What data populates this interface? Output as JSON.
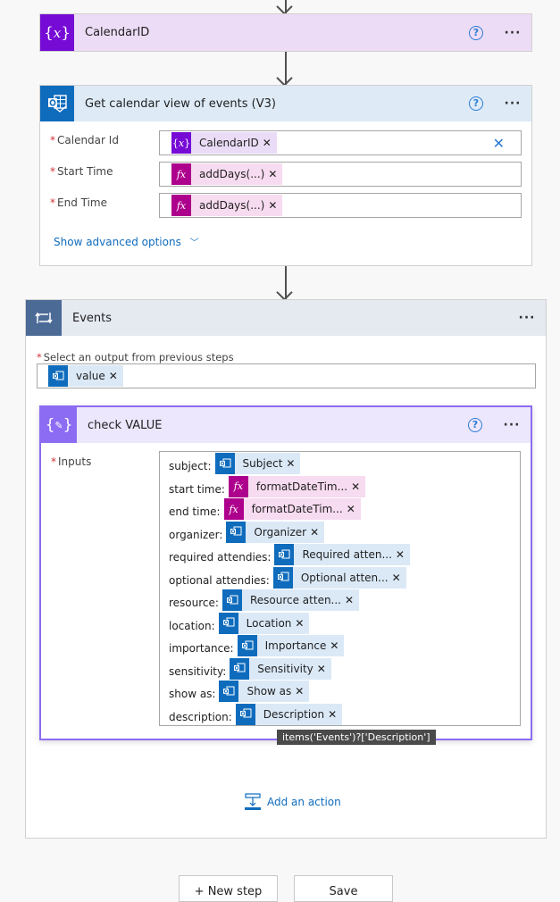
{
  "flow": {
    "calendar_var_step": {
      "title": "CalendarID",
      "icon": "variable-icon",
      "color": "#770bd6",
      "header_bg": "#eddcf6"
    },
    "get_calendar_step": {
      "title": "Get calendar view of events (V3)",
      "icon": "outlook-icon",
      "color": "#0f6cbd",
      "header_bg": "#deebf7",
      "fields": [
        {
          "label": "Calendar Id",
          "required": true,
          "token": {
            "type": "variable",
            "text": "CalendarID"
          },
          "clear_button": true
        },
        {
          "label": "Start Time",
          "required": true,
          "token": {
            "type": "expression",
            "text": "addDays(...)"
          }
        },
        {
          "label": "End Time",
          "required": true,
          "token": {
            "type": "expression",
            "text": "addDays(...)"
          }
        }
      ],
      "advanced_link": "Show advanced options"
    },
    "events_loop": {
      "title": "Events",
      "icon": "loop-icon",
      "color": "#4b6a96",
      "header_bg": "#e5e9f0",
      "select_label": "Select an output from previous steps",
      "select_token": {
        "type": "outlook",
        "text": "value"
      },
      "add_action_label": "Add an action"
    },
    "check_value_step": {
      "title": "check VALUE",
      "icon": "compose-icon",
      "color": "#8c6cf2",
      "header_bg": "#ede7fd",
      "inputs_label": "Inputs",
      "inputs": [
        {
          "label": "subject:",
          "type": "outlook",
          "token": "Subject"
        },
        {
          "label": "start time:",
          "type": "expression",
          "token": "formatDateTim..."
        },
        {
          "label": "end time:",
          "type": "expression",
          "token": "formatDateTim..."
        },
        {
          "label": "organizer:",
          "type": "outlook",
          "token": "Organizer"
        },
        {
          "label": "required attendies:",
          "type": "outlook",
          "token": "Required atten..."
        },
        {
          "label": "optional attendies:",
          "type": "outlook",
          "token": "Optional atten..."
        },
        {
          "label": "resource:",
          "type": "outlook",
          "token": "Resource atten..."
        },
        {
          "label": "location:",
          "type": "outlook",
          "token": "Location"
        },
        {
          "label": "importance:",
          "type": "outlook",
          "token": "Importance"
        },
        {
          "label": "sensitivity:",
          "type": "outlook",
          "token": "Sensitivity"
        },
        {
          "label": "show as:",
          "type": "outlook",
          "token": "Show as"
        },
        {
          "label": "description:",
          "type": "outlook",
          "token": "Description"
        }
      ],
      "tooltip": "items('Events')?['Description']"
    }
  },
  "footer": {
    "new_step": "+ New step",
    "save": "Save"
  }
}
